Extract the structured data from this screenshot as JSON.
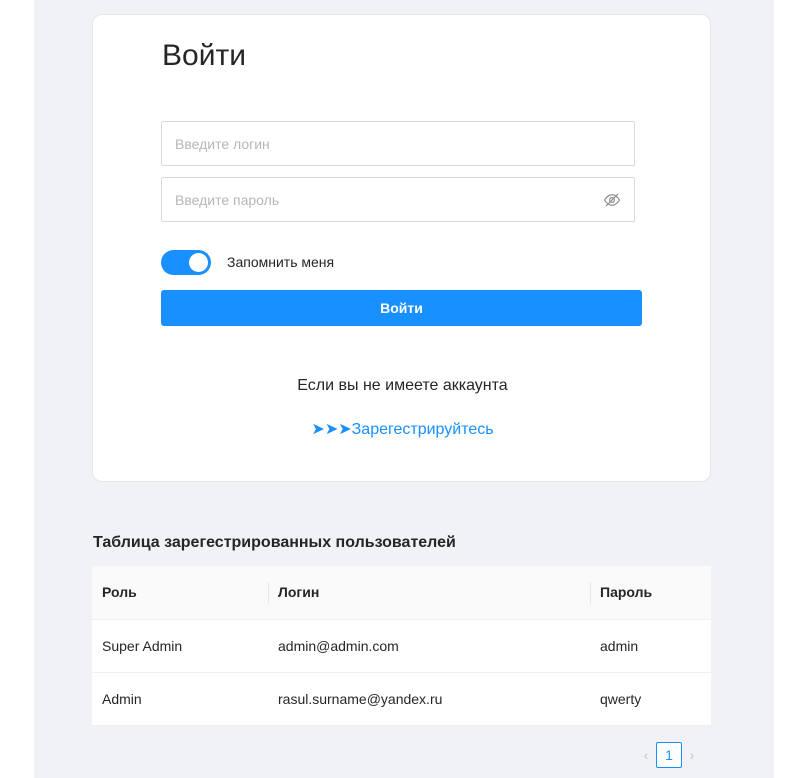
{
  "login": {
    "title": "Войти",
    "login_placeholder": "Введите логин",
    "password_placeholder": "Введите пароль",
    "remember_label": "Запомнить меня",
    "remember_checked": true,
    "submit_label": "Войти",
    "no_account_text": "Если вы не имеете аккаунта",
    "register_link": "➤➤➤Зарегестрируйтесь"
  },
  "users_table": {
    "title": "Таблица зарегестрированных пользователей",
    "columns": [
      "Роль",
      "Логин",
      "Пароль"
    ],
    "rows": [
      [
        "Super Admin",
        "admin@admin.com",
        "admin"
      ],
      [
        "Admin",
        "rasul.surname@yandex.ru",
        "qwerty"
      ]
    ]
  },
  "pagination": {
    "current_page": "1",
    "prev_icon": "chevron-left-icon",
    "next_icon": "chevron-right-icon"
  },
  "colors": {
    "accent": "#1890ff",
    "background": "#f0f2f5"
  }
}
